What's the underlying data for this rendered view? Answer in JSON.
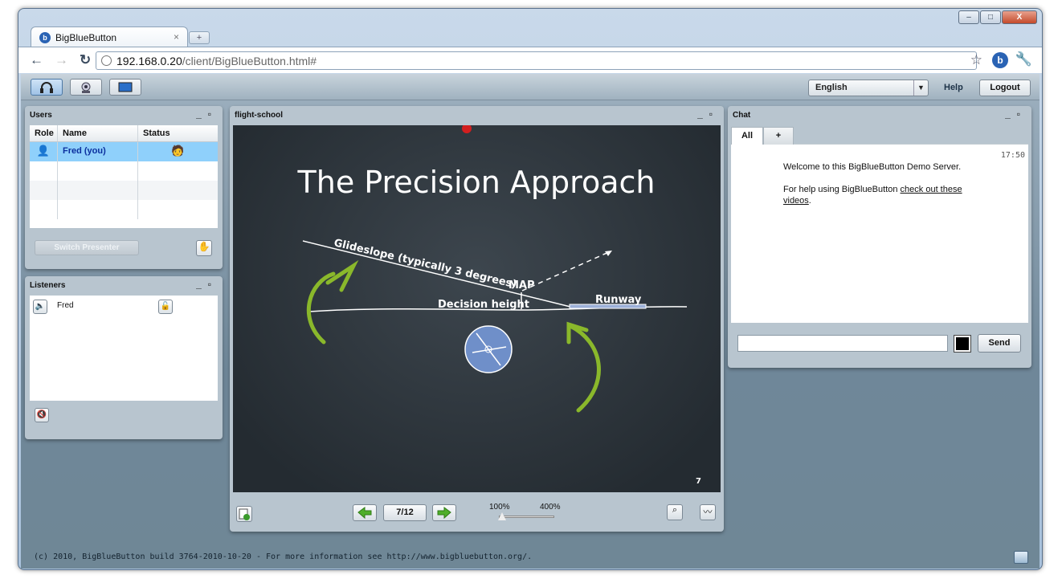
{
  "browser": {
    "tab_title": "BigBlueButton",
    "tab_close": "×",
    "new_tab": "+",
    "url_host": "192.168.0.20",
    "url_path": "/client/BigBlueButton.html#",
    "window_controls": {
      "minimize": "–",
      "maximize": "□",
      "close": "X"
    }
  },
  "toolbar": {
    "language": "English",
    "help": "Help",
    "logout": "Logout"
  },
  "users_panel": {
    "title": "Users",
    "columns": [
      "Role",
      "Name",
      "Status"
    ],
    "rows": [
      {
        "name": "Fred (you)"
      }
    ],
    "switch_presenter": "Switch Presenter"
  },
  "listeners_panel": {
    "title": "Listeners",
    "rows": [
      {
        "name": "Fred"
      }
    ]
  },
  "presentation": {
    "title": "flight-school",
    "slide": {
      "heading": "The Precision Approach",
      "glideslope": "Glideslope (typically 3 degrees)",
      "map": "MAP",
      "decision_height": "Decision height",
      "runway": "Runway",
      "page_number": "7"
    },
    "page_indicator": "7/12",
    "zoom_min": "100%",
    "zoom_max": "400%",
    "zoom_level_fraction": 0.0
  },
  "chat_panel": {
    "title": "Chat",
    "tabs": [
      "All",
      "+"
    ],
    "message": {
      "time": "17:50",
      "welcome": "Welcome to this BigBlueButton Demo Server.",
      "help_prefix": "For help using BigBlueButton ",
      "help_link_1": "check out these ",
      "help_link_2": "videos",
      "help_suffix": "."
    },
    "input_value": "",
    "send": "Send",
    "text_color": "#000000"
  },
  "footer": {
    "text": "(c) 2010, BigBlueButton build 3764-2010-10-20 - For more information see http://www.bigbluebutton.org/."
  }
}
